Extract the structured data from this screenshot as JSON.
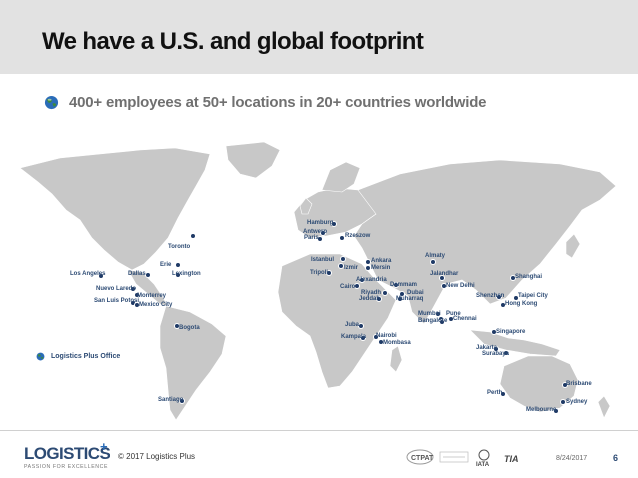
{
  "header": {
    "title": "We have a U.S. and global footprint"
  },
  "bullet": {
    "text": "400+ employees at 50+ locations in 20+ countries worldwide"
  },
  "legend": {
    "label": "Logistics Plus Office"
  },
  "cities": [
    "Toronto",
    "Erie",
    "Lexington",
    "Los Angeles",
    "Dallas",
    "Nuevo Laredo",
    "Monterrey",
    "San Luis Potosi",
    "Mexico City",
    "Bogota",
    "Santiago",
    "Hamburg",
    "Antwerp",
    "Paris",
    "Rzeszow",
    "Istanbul",
    "Ankara",
    "Izmir",
    "Mersin",
    "Tripoli",
    "Alexandria",
    "Cairo",
    "Riyadh",
    "Dammam",
    "Dubai",
    "Muharraq",
    "Jeddah",
    "Juba",
    "Kampala",
    "Nairobi",
    "Mombasa",
    "Almaty",
    "Jalandhar",
    "New Delhi",
    "Mumbai",
    "Pune",
    "Bangalore",
    "Chennai",
    "Shanghai",
    "Shenzhen",
    "Taipei City",
    "Hong Kong",
    "Singapore",
    "Jakarta",
    "Surabaya",
    "Brisbane",
    "Perth",
    "Sydney",
    "Melbourne"
  ],
  "footer": {
    "copyright": "© 2017 Logistics Plus",
    "logo_text": "LOGISTICS",
    "logo_plus": "+",
    "logo_tagline": "PASSION FOR EXCELLENCE",
    "partner_1": "CTPAT",
    "partner_2": "IATA",
    "partner_3": "TIA",
    "date": "8/24/2017",
    "page_number": "6"
  },
  "colors": {
    "title_bar": "#e2e2e2",
    "map_land": "#c8c8c8",
    "dot": "#1f3a66",
    "label": "#2d4b74",
    "accent": "#2a6cb8"
  }
}
